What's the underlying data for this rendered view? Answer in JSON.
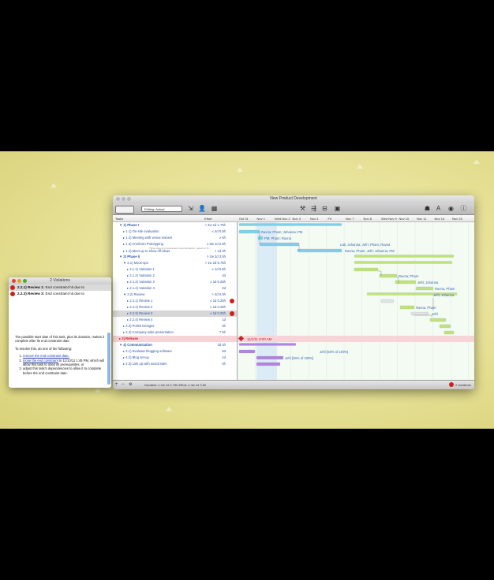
{
  "window": {
    "title": "New Product Development",
    "toolbar": {
      "baseline_select": "Editing: Actual"
    }
  },
  "outline": {
    "headers": {
      "tasks": "Tasks",
      "effort": "Effort"
    },
    "rows": [
      {
        "name": "▼ 1)  Phase I",
        "effort": "> 4w 1d 1.75h",
        "level": 0
      },
      {
        "name": "▸ 1.1)  On-site evaluation",
        "effort": "≤ 4d 0.5h",
        "level": 1
      },
      {
        "name": "▸ 1.2)  Meeting with venue owners",
        "effort": "≥ 6h",
        "level": 1
      },
      {
        "name": "▸ 1.3)  Freeform Prototyping",
        "effort": "≥ 5w 1d 2.5h",
        "level": 1
      },
      {
        "name": "▸ 1.4)  Meet up to show off ideas",
        "effort": "> 1d 2h",
        "level": 1
      },
      {
        "name": "▼ 2)  Phase II",
        "effort": "> 2w 2d 3.5h",
        "level": 0
      },
      {
        "name": "▼ 2.1)  Mock-ups",
        "effort": "> 1w 2d 5.75h",
        "level": 1
      },
      {
        "name": "▸ 2.1.1)  Variation 1",
        "effort": "≤ 1d 0.5h",
        "level": 2
      },
      {
        "name": "▸ 2.1.2)  Variation 2",
        "effort": "2d",
        "level": 2
      },
      {
        "name": "▸ 2.1.3)  Variation 3",
        "effort": "≥ 1d 5.25h",
        "level": 2
      },
      {
        "name": "▸ 2.1.4)  Variation 4",
        "effort": "2d",
        "level": 2
      },
      {
        "name": "▼ 2.2)  Review",
        "effort": "> 4d 0.5h",
        "level": 1
      },
      {
        "name": "▸ 2.2.1)  Review 1",
        "effort": "≤ 1d 0.25h",
        "level": 2,
        "warn": true
      },
      {
        "name": "▸ 2.2.2)  Review 2",
        "effort": "≤ 1d 0.25h",
        "level": 2
      },
      {
        "name": "▸ 2.2.3)  Review 3",
        "effort": "≤ 1d 0.25h",
        "level": 2,
        "warn": true,
        "selected": true
      },
      {
        "name": "▸ 2.2.4)  Review 4",
        "effort": "1d",
        "level": 2
      },
      {
        "name": "▸ 2.3)  Polish Designs",
        "effort": "3h",
        "level": 1
      },
      {
        "name": "▸ 2.4)  Company-wide presentation",
        "effort": "7.5h",
        "level": 1
      },
      {
        "name": "▸ 3)  Release",
        "effort": "",
        "level": 0,
        "milestone": true
      },
      {
        "name": "▼ 4)  Communication",
        "effort": "2d 4h",
        "level": 0
      },
      {
        "name": "▸ 4.1)  Evaluate blogging software",
        "effort": "5d",
        "level": 1
      },
      {
        "name": "▸ 4.2)  Blog set-up",
        "effort": "1d",
        "level": 1
      },
      {
        "name": "▸ 4.3)  Link up with social sites",
        "effort": "4h",
        "level": 1
      }
    ],
    "note": "Three days of unrestrained experimentation, based on th..."
  },
  "timeline": {
    "dates": [
      "Oct 31",
      "Nov 1",
      "Wed Nov 2",
      "Nov 3",
      "Nov 4",
      "Fri",
      "Nov 7",
      "Nov 8",
      "Wed Nov 9",
      "Nov 10",
      "Nov 11",
      "Nov 14",
      "Nov 15"
    ],
    "bar_labels": [
      "Ravna; Pham; Johanna; PM",
      "PM; Pham; Ravna",
      "Lab; Johanna; Jefri; Pham; Ravna",
      "Ravna; Pham; Jefri; Johanna; PM",
      "Ravna; Pham",
      "Jefri; Johanna",
      "Ravna; Pham",
      "Jefri; Johanna",
      "Ravna; Pham",
      "Jefri",
      "Jefri [50% of 100%]",
      "Jefri [50% of 100%]"
    ],
    "milestone_label": "11/1/11 8:00 AM"
  },
  "status_bar": {
    "summary": "Duration: ≤ 2w 1d 2.75h Effort: ≥ 4w 1d 3.5h",
    "violations": "2 violations"
  },
  "violations_panel": {
    "title": "2 Violations",
    "items": [
      {
        "id": "2.2.1) Review 1:",
        "text": "End constraint hit due to"
      },
      {
        "id": "2.2.3) Review 3:",
        "text": "End constraint hit due to"
      }
    ],
    "description": "The possible start date of this task, plus its duration, makes it complete after its end constraint date.",
    "resolve_intro": "To resolve this, do one of the following:",
    "options": [
      {
        "link": "remove the end constraint date,",
        "text": ""
      },
      {
        "link": "move the end constraint",
        "text": " to 11/10/11 1:45 PM, which will allow this task to obey its prerequisites, or"
      },
      {
        "link": "",
        "text": "adjust this task's dependencies to allow it to complete before the end constraint date."
      }
    ]
  },
  "colors": {
    "background": "#e9e49c",
    "bar_blue": "#7fd0e6",
    "bar_green": "#bfe27a",
    "bar_purple": "#b482e0",
    "warning_red": "#c8231c",
    "milestone_pink": "#f6d4d8"
  }
}
